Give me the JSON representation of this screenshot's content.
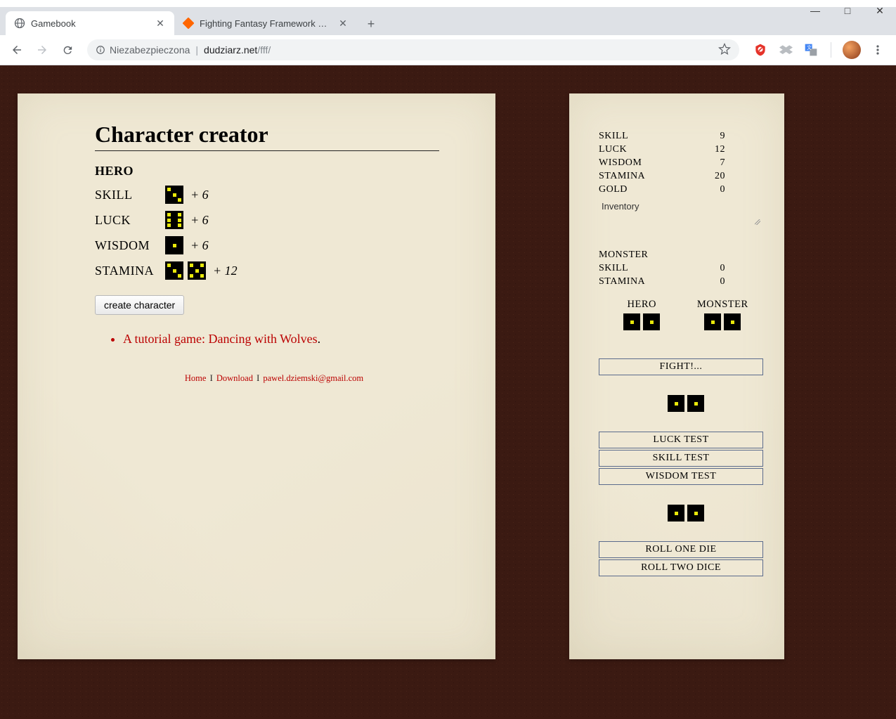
{
  "window": {
    "minimize": "—",
    "maximize": "□",
    "close": "✕"
  },
  "tabs": {
    "tab1": {
      "title": "Gamebook"
    },
    "tab2": {
      "title": "Fighting Fantasy Framework dow"
    }
  },
  "omnibox": {
    "security_label": "Niezabezpieczona",
    "host": "dudziarz.net",
    "path": "/fff/"
  },
  "main": {
    "heading": "Character creator",
    "hero_label": "HERO",
    "stats": {
      "skill": {
        "label": "SKILL",
        "suffix": "+ 6"
      },
      "luck": {
        "label": "LUCK",
        "suffix": "+ 6"
      },
      "wisdom": {
        "label": "WISDOM",
        "suffix": "+ 6"
      },
      "stamina": {
        "label": "STAMINA",
        "suffix": "+ 12"
      }
    },
    "create_button": "create character",
    "tutorial_text": "A tutorial game: Dancing with Wolves",
    "tutorial_dot": ".",
    "footer": {
      "home": "Home",
      "download": "Download",
      "email": "pawel.dziemski@gmail.com",
      "sep": "I"
    }
  },
  "side": {
    "stats": {
      "skill": {
        "label": "SKILL",
        "value": "9"
      },
      "luck": {
        "label": "LUCK",
        "value": "12"
      },
      "wisdom": {
        "label": "WISDOM",
        "value": "7"
      },
      "stamina": {
        "label": "STAMINA",
        "value": "20"
      },
      "gold": {
        "label": "GOLD",
        "value": "0"
      }
    },
    "inventory_label": "Inventory",
    "monster_label": "MONSTER",
    "monster_stats": {
      "skill": {
        "label": "SKILL",
        "value": "0"
      },
      "stamina": {
        "label": "STAMINA",
        "value": "0"
      }
    },
    "combat": {
      "hero_label": "HERO",
      "monster_label": "MONSTER"
    },
    "buttons": {
      "fight": "FIGHT!...",
      "luck_test": "LUCK TEST",
      "skill_test": "SKILL TEST",
      "wisdom_test": "WISDOM TEST",
      "roll_one": "ROLL ONE DIE",
      "roll_two": "ROLL TWO DICE"
    }
  }
}
